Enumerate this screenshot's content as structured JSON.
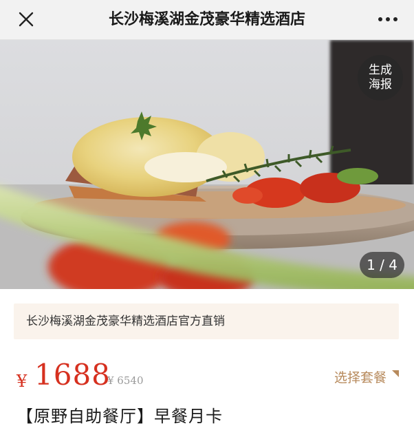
{
  "navbar": {
    "title": "长沙梅溪湖金茂豪华精选酒店",
    "close_icon": "close-icon",
    "more_icon": "more-dots-icon"
  },
  "hero": {
    "poster_button": {
      "line1": "生成",
      "line2": "海报"
    },
    "counter": "1 / 4"
  },
  "store_banner": {
    "text": "长沙梅溪湖金茂豪华精选酒店官方直销"
  },
  "price": {
    "currency": "¥",
    "value": "1688",
    "original": "¥ 6540",
    "accent_color": "#d6301f"
  },
  "select_package": {
    "label": "选择套餐",
    "color": "#b78a5c"
  },
  "product": {
    "title": "【原野自助餐厅】早餐月卡"
  }
}
